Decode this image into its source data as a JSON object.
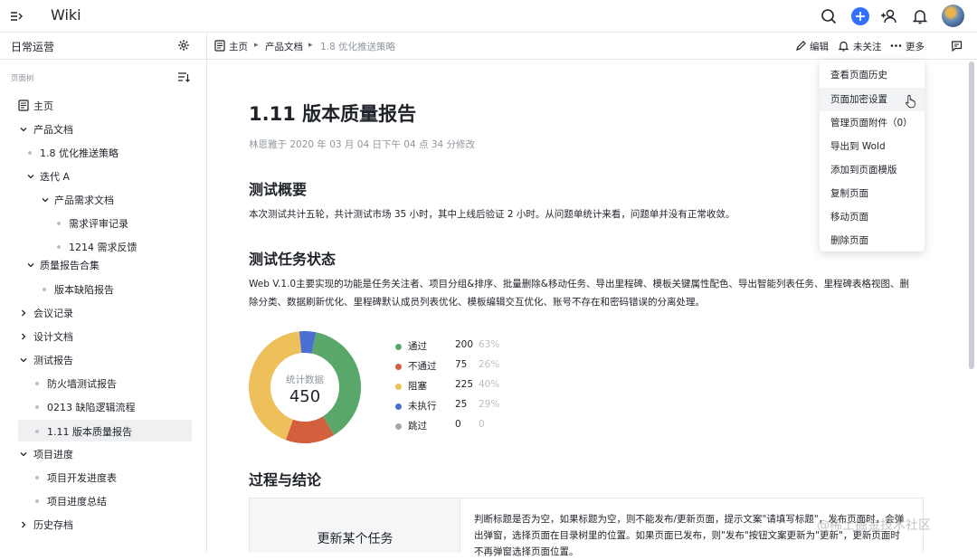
{
  "app": {
    "title": "Wiki"
  },
  "sidebar": {
    "space_title": "日常运营",
    "tree_label": "页面树",
    "items": [
      {
        "label": "主页"
      },
      {
        "label": "产品文档"
      },
      {
        "label": "1.8 优化推送策略"
      },
      {
        "label": "迭代 A"
      },
      {
        "label": "产品需求文档"
      },
      {
        "label": "需求评审记录"
      },
      {
        "label": "1214 需求反馈"
      },
      {
        "label": "质量报告合集"
      },
      {
        "label": "版本缺陷报告"
      },
      {
        "label": "会议记录"
      },
      {
        "label": "设计文档"
      },
      {
        "label": "测试报告"
      },
      {
        "label": "防火墙测试报告"
      },
      {
        "label": "0213 缺陷逻辑流程"
      },
      {
        "label": "1.11 版本质量报告"
      },
      {
        "label": "项目进度"
      },
      {
        "label": "项目开发进度表"
      },
      {
        "label": "项目进度总结"
      },
      {
        "label": "历史存档"
      }
    ]
  },
  "breadcrumb": {
    "home": "主页",
    "parent": "产品文档",
    "current": "1.8 优化推送策略"
  },
  "actions": {
    "edit": "编辑",
    "follow": "未关注",
    "more": "更多"
  },
  "doc": {
    "title": "1.11 版本质量报告",
    "meta": "林恩雅于 2020 年 03 月 04 日下午 04 点 34 分修改",
    "section1_title": "测试概要",
    "section1_text": "本次测试共计五轮，共计测试市场 35 小时，其中上线后验证 2 小时。从问题单统计来看，问题单并没有正常收敛。",
    "section2_title": "测试任务状态",
    "section2_line1": "Web V.1.0主要实现的功能是任务关注者、项目分组&排序、批量删除&移动任务、导出里程碑、模板关键属性配色、导出智能列表任务、里程碑表格视图、删",
    "section2_line2": "除分类、数据刷新优化、里程碑默认成员列表优化、模板编辑交互优化、账号不存在和密码错误的分离处理。",
    "section3_title": "过程与结论",
    "table_left": "更新某个任务",
    "table_right": "判断标题是否为空，如果标题为空，则不能发布/更新页面，提示文案\"请填写标题\"，发布页面时，会弹出弹窗，选择页面在目录树里的位置。如果页面已发布，则\"发布\"按钮文案更新为\"更新\"，更新页面时不再弹窗选择页面位置。"
  },
  "chart_data": {
    "type": "pie",
    "center_label": "统计数据",
    "total": 450,
    "series": [
      {
        "name": "通过",
        "value": 200,
        "percent": "63%",
        "color": "#5aa76a"
      },
      {
        "name": "不通过",
        "value": 75,
        "percent": "26%",
        "color": "#d2603f"
      },
      {
        "name": "阻塞",
        "value": 225,
        "percent": "40%",
        "color": "#eec05b"
      },
      {
        "name": "未执行",
        "value": 25,
        "percent": "29%",
        "color": "#4a6fd0"
      },
      {
        "name": "跳过",
        "value": 0,
        "percent": "0",
        "color": "#a8a8a8"
      }
    ]
  },
  "dropdown": {
    "items": [
      "查看页面历史",
      "页面加密设置",
      "管理页面附件（0）",
      "导出到 Wold",
      "添加到页面模版",
      "复制页面",
      "移动页面",
      "删除页面"
    ]
  },
  "watermark": "@稀土掘金技术社区",
  "colors": {
    "accent": "#3370ff"
  }
}
